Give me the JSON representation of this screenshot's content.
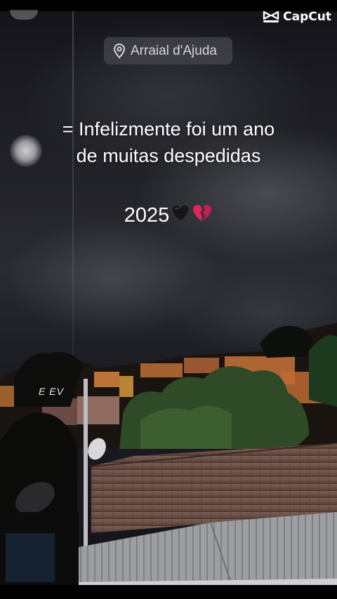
{
  "watermark": {
    "brand": "CapCut"
  },
  "location": {
    "label": "Arraial d'Ajuda",
    "icon": "location-pin-icon"
  },
  "caption": {
    "line1": "= Infelizmente foi um ano",
    "line2": "de muitas despedidas",
    "year": "2025"
  },
  "emojis": [
    "black-heart-icon",
    "broken-heart-icon"
  ],
  "graffiti": "E EV",
  "colors": {
    "accent_heart": "#e0245e",
    "sky": "#2a2a31",
    "roof": "#6b5148"
  }
}
